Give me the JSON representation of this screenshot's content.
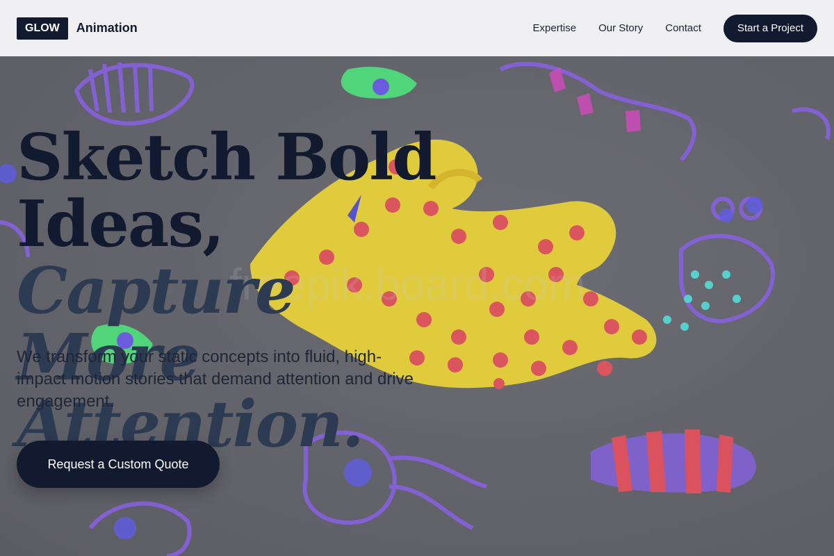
{
  "header": {
    "logo_badge": "GLOW",
    "logo_text": "Animation",
    "nav": [
      "Expertise",
      "Our Story",
      "Contact"
    ],
    "cta_label": "Start a Project"
  },
  "hero": {
    "headline_plain": "Sketch Bold Ideas,",
    "headline_italic_1": "Capture",
    "headline_italic_2": "More Attention.",
    "subtext": "We transform your static concepts into fluid, high-impact motion stories that demand attention and drive engagement.",
    "button_label": "Request a Custom Quote",
    "watermark": "freepik.board.com"
  },
  "colors": {
    "brand_dark": "#111a2e",
    "header_bg": "#f0f0f2",
    "creature_yellow": "#f7dd2f",
    "spot_red": "#ef4d56",
    "neon_purple": "#8a5cf6",
    "neon_green": "#48f07a"
  }
}
